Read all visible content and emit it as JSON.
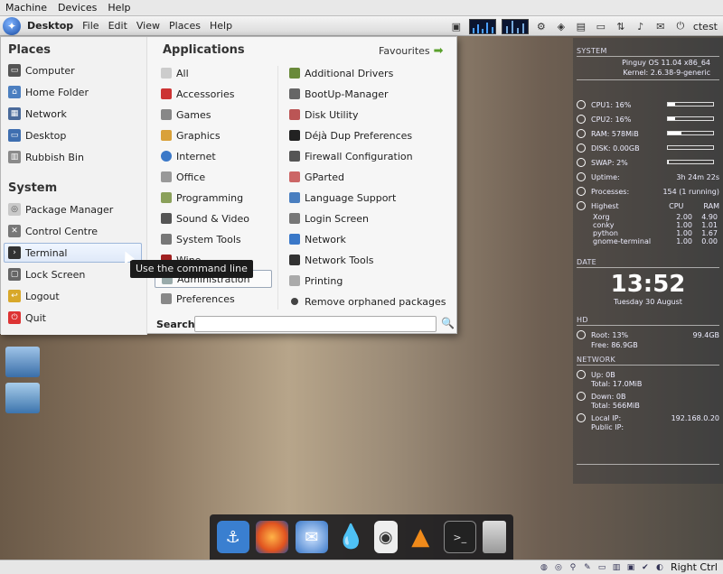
{
  "host_menubar": [
    "Machine",
    "Devices",
    "Help"
  ],
  "top_panel": {
    "menus": [
      "Desktop",
      "File",
      "Edit",
      "View",
      "Places",
      "Help"
    ],
    "user": "ctest"
  },
  "places": {
    "title": "Places",
    "items": [
      {
        "label": "Computer",
        "icon": "computer-icon"
      },
      {
        "label": "Home Folder",
        "icon": "home-folder-icon"
      },
      {
        "label": "Network",
        "icon": "network-icon"
      },
      {
        "label": "Desktop",
        "icon": "desktop-icon"
      },
      {
        "label": "Rubbish Bin",
        "icon": "trash-icon"
      }
    ]
  },
  "system": {
    "title": "System",
    "items": [
      {
        "label": "Package Manager",
        "icon": "package-icon"
      },
      {
        "label": "Control Centre",
        "icon": "control-centre-icon"
      },
      {
        "label": "Terminal",
        "icon": "terminal-icon"
      },
      {
        "label": "Lock Screen",
        "icon": "lock-icon"
      },
      {
        "label": "Logout",
        "icon": "logout-icon"
      },
      {
        "label": "Quit",
        "icon": "quit-icon"
      }
    ],
    "selected": "Terminal"
  },
  "applications": {
    "title": "Applications",
    "favourites": "Favourites",
    "categories": [
      "All",
      "Accessories",
      "Games",
      "Graphics",
      "Internet",
      "Office",
      "Programming",
      "Sound & Video",
      "System Tools",
      "Wine",
      "Administration",
      "Preferences"
    ],
    "active_category": "Administration",
    "apps": [
      "Additional Drivers",
      "BootUp-Manager",
      "Disk Utility",
      "Déjà Dup Preferences",
      "Firewall Configuration",
      "GParted",
      "Language Support",
      "Login Screen",
      "Network",
      "Network Tools",
      "Printing",
      "Remove orphaned packages"
    ]
  },
  "search": {
    "label": "Search:",
    "value": ""
  },
  "tooltip": "Use the command line",
  "conky": {
    "system_header": "SYSTEM",
    "os": "Pinguy OS 11.04 x86_64",
    "kernel": "Kernel: 2.6.38-9-generic",
    "cpu1": "CPU1: 16%",
    "cpu2": "CPU2: 16%",
    "ram": "RAM: 578MiB",
    "disk": "DISK: 0.00GB",
    "swap": "SWAP: 2%",
    "uptime_label": "Uptime:",
    "uptime_value": "3h 24m 22s",
    "processes_label": "Processes:",
    "processes_value": "154 (1 running)",
    "highest_label": "Highest",
    "cpu_col": "CPU",
    "ram_col": "RAM",
    "procs": [
      {
        "name": "Xorg",
        "cpu": "2.00",
        "ram": "4.90"
      },
      {
        "name": "conky",
        "cpu": "1.00",
        "ram": "1.01"
      },
      {
        "name": "python",
        "cpu": "1.00",
        "ram": "1.67"
      },
      {
        "name": "gnome-terminal",
        "cpu": "1.00",
        "ram": "0.00"
      }
    ],
    "date_header": "DATE",
    "time": "13:52",
    "date": "Tuesday 30 August",
    "hd_header": "HD",
    "root": "Root: 13%",
    "root_size": "99.4GB",
    "free": "Free: 86.9GB",
    "network_header": "NETWORK",
    "up": "Up: 0B",
    "up_total": "Total: 17.0MiB",
    "down": "Down: 0B",
    "down_total": "Total: 566MiB",
    "local_ip_label": "Local IP:",
    "local_ip": "192.168.0.20",
    "public_ip_label": "Public IP:"
  },
  "dock": [
    {
      "name": "anchor",
      "icon": "anchor-icon"
    },
    {
      "name": "firefox",
      "icon": "firefox-icon"
    },
    {
      "name": "thunderbird",
      "icon": "mail-icon"
    },
    {
      "name": "water",
      "icon": "drop-icon"
    },
    {
      "name": "speaker",
      "icon": "speaker-icon"
    },
    {
      "name": "vlc",
      "icon": "vlc-icon"
    },
    {
      "name": "terminal",
      "icon": "terminal-icon"
    },
    {
      "name": "trash",
      "icon": "trash-icon"
    }
  ],
  "statusbar": {
    "host_key": "Right Ctrl"
  },
  "colors": {
    "accent": "#1a4fa8",
    "selection": "#dfe9f8"
  }
}
